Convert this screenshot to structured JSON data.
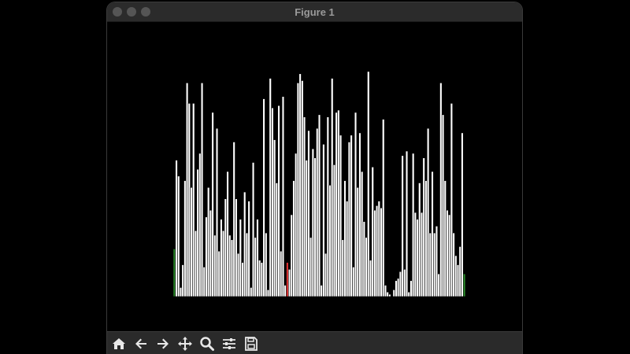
{
  "window": {
    "title": "Figure 1"
  },
  "colors": {
    "bar_default": "#ffffff",
    "bar_edge": "#000000",
    "bar_highlight": "#e03030",
    "bar_sorted": "#2a8a2a",
    "background": "#000000"
  },
  "toolbar": {
    "buttons": [
      "home-icon",
      "back-icon",
      "forward-icon",
      "pan-icon",
      "zoom-icon",
      "configure-subplots-icon",
      "save-icon"
    ]
  },
  "chart_data": {
    "type": "bar",
    "ylim": [
      0,
      100
    ],
    "grid": false,
    "axes_visible": false,
    "values": [
      21,
      60,
      53,
      4,
      14,
      51,
      94,
      85,
      48,
      85,
      29,
      56,
      63,
      94,
      13,
      35,
      48,
      38,
      81,
      27,
      74,
      20,
      34,
      29,
      43,
      55,
      27,
      25,
      68,
      43,
      19,
      34,
      15,
      46,
      28,
      42,
      4,
      59,
      26,
      34,
      16,
      15,
      87,
      28,
      3,
      96,
      83,
      69,
      50,
      84,
      20,
      88,
      5,
      15,
      12,
      36,
      51,
      63,
      94,
      98,
      95,
      79,
      60,
      73,
      26,
      65,
      61,
      74,
      80,
      5,
      67,
      19,
      79,
      49,
      96,
      58,
      81,
      82,
      71,
      25,
      51,
      42,
      68,
      71,
      13,
      81,
      48,
      72,
      55,
      33,
      26,
      99,
      16,
      57,
      38,
      40,
      42,
      39,
      78,
      5,
      2,
      1,
      0,
      3,
      7,
      8,
      11,
      62,
      12,
      64,
      2,
      7,
      63,
      37,
      34,
      50,
      37,
      61,
      51,
      74,
      28,
      55,
      28,
      31,
      10,
      94,
      80,
      51,
      38,
      36,
      85,
      28,
      18,
      14,
      22,
      72,
      10
    ],
    "bar_states": [
      "sorted",
      "default",
      "default",
      "default",
      "default",
      "default",
      "default",
      "default",
      "default",
      "default",
      "default",
      "default",
      "default",
      "default",
      "default",
      "default",
      "default",
      "default",
      "default",
      "default",
      "default",
      "default",
      "default",
      "default",
      "default",
      "default",
      "default",
      "default",
      "default",
      "default",
      "default",
      "default",
      "default",
      "default",
      "default",
      "default",
      "default",
      "default",
      "default",
      "default",
      "default",
      "default",
      "default",
      "default",
      "default",
      "default",
      "default",
      "default",
      "default",
      "default",
      "default",
      "default",
      "default",
      "default",
      "default",
      "default",
      "default",
      "default",
      "default",
      "default",
      "default",
      "default",
      "default",
      "default",
      "default",
      "default",
      "default",
      "default",
      "default",
      "default",
      "default",
      "default",
      "default",
      "default",
      "default",
      "default",
      "default",
      "default",
      "default",
      "default",
      "default",
      "default",
      "default",
      "default",
      "default",
      "default",
      "default",
      "default",
      "default",
      "default",
      "default",
      "default",
      "default",
      "default",
      "default",
      "default",
      "default",
      "default",
      "default",
      "default",
      "default",
      "default",
      "default",
      "default",
      "default",
      "default",
      "default",
      "default",
      "default",
      "default",
      "default",
      "default",
      "default",
      "default",
      "default",
      "default",
      "default",
      "default",
      "default",
      "default",
      "default",
      "default",
      "default",
      "default",
      "default",
      "default",
      "default",
      "default",
      "default",
      "default",
      "default",
      "default",
      "default",
      "default",
      "default",
      "default",
      "sorted"
    ],
    "highlight_index": 53
  }
}
